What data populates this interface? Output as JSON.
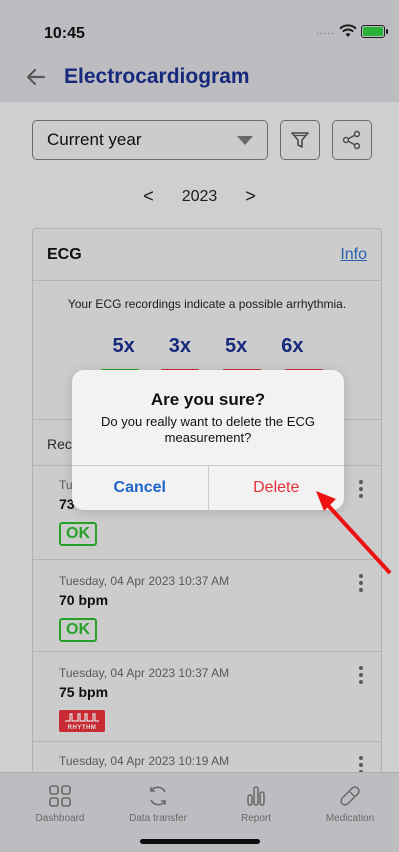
{
  "status_bar": {
    "time": "10:45",
    "signal": "....."
  },
  "header": {
    "title": "Electrocardiogram"
  },
  "filters": {
    "period": "Current year"
  },
  "year_nav": {
    "prev": "<",
    "year": "2023",
    "next": ">"
  },
  "ecg_card": {
    "title": "ECG",
    "info_link": "Info",
    "message": "Your ECG recordings indicate a possible arrhythmia.",
    "counts": [
      "5x",
      "3x",
      "5x",
      "6x"
    ],
    "recordings_label": "Rec"
  },
  "recordings": [
    {
      "date": "Tu",
      "bpm": "73",
      "status": "OK"
    },
    {
      "date": "Tuesday, 04 Apr 2023 10:37 AM",
      "bpm": "70 bpm",
      "status": "OK"
    },
    {
      "date": "Tuesday, 04 Apr 2023 10:37 AM",
      "bpm": "75 bpm",
      "status": "RHYTHM"
    },
    {
      "date": "Tuesday, 04 Apr 2023 10:19 AM",
      "bpm": "",
      "status": ""
    }
  ],
  "dialog": {
    "title": "Are you sure?",
    "message": "Do you really want to delete the ECG measurement?",
    "cancel_label": "Cancel",
    "delete_label": "Delete"
  },
  "tab_bar": {
    "tabs": [
      {
        "label": "Dashboard",
        "icon": "dashboard-icon"
      },
      {
        "label": "Data transfer",
        "icon": "sync-icon"
      },
      {
        "label": "Report",
        "icon": "report-icon"
      },
      {
        "label": "Medication",
        "icon": "pill-icon"
      }
    ]
  },
  "colors": {
    "accent": "#1b2f8f",
    "ok": "#2db82d",
    "danger": "#e5323a",
    "link": "#2f6fc7"
  }
}
